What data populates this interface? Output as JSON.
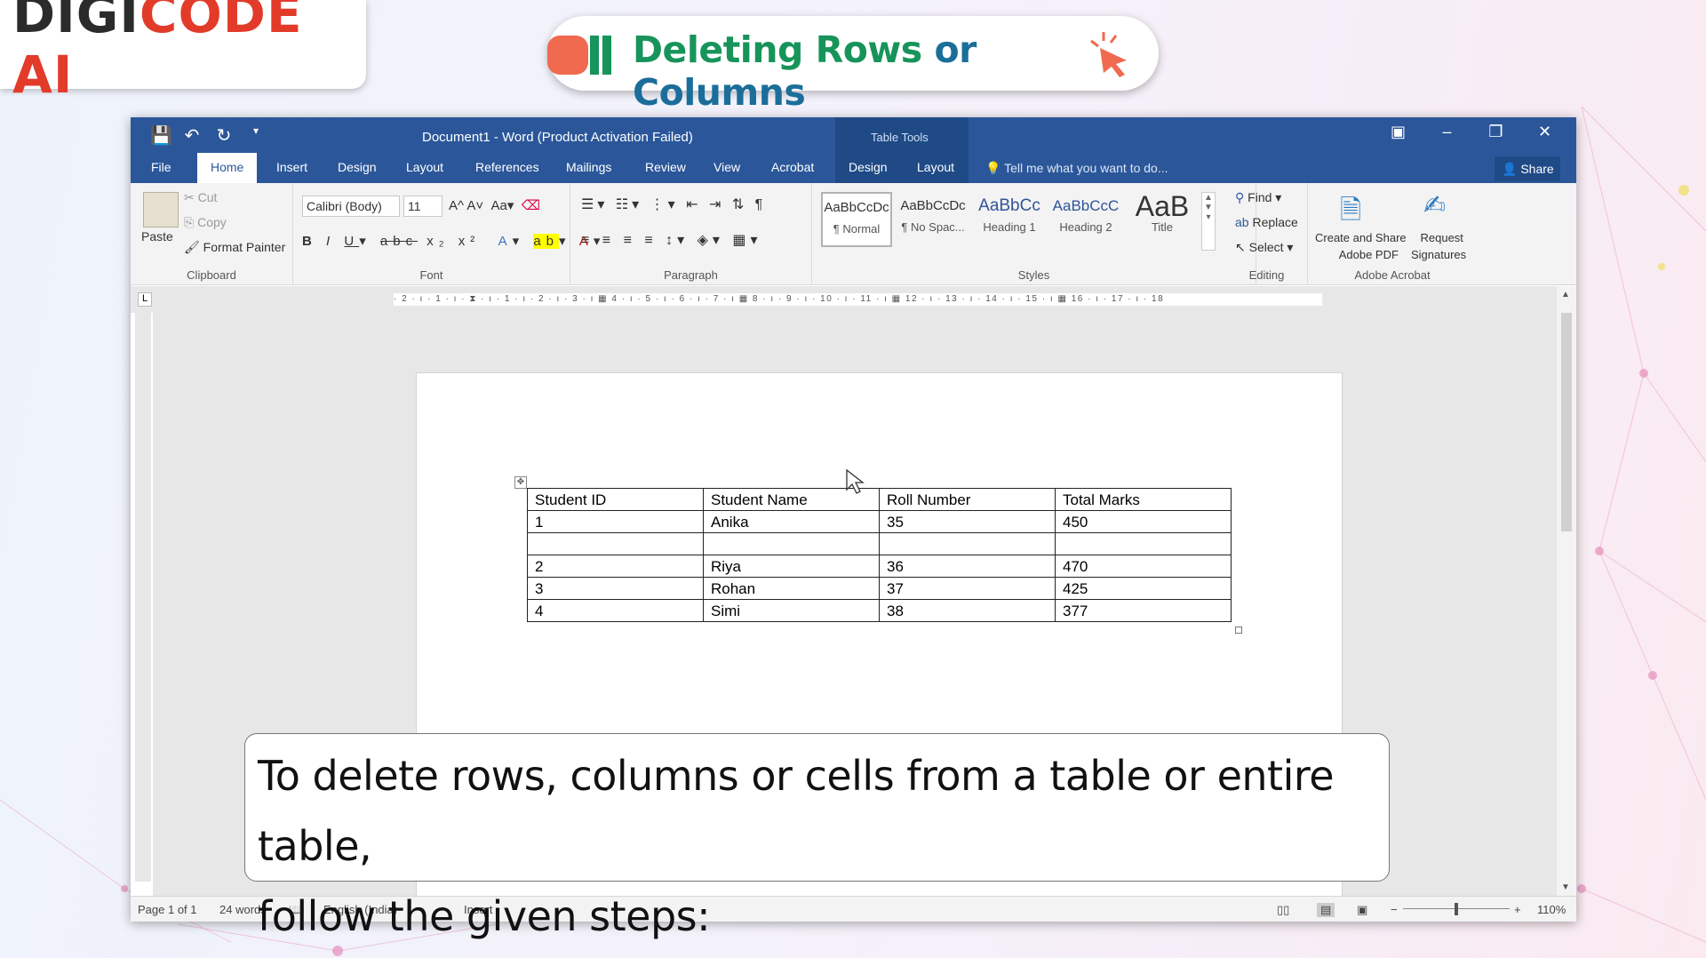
{
  "brand": {
    "logo_dark": "DIGI",
    "logo_red": "CODE",
    "logo_dark2": " AI"
  },
  "banner": {
    "title_green": "Deleting Rows ",
    "title_blue": "or Columns"
  },
  "word": {
    "window_title": "Document1 - Word (Product Activation Failed)",
    "table_tools_label": "Table Tools",
    "tabs": [
      "File",
      "Home",
      "Insert",
      "Design",
      "Layout",
      "References",
      "Mailings",
      "Review",
      "View",
      "Acrobat",
      "Design",
      "Layout"
    ],
    "tell_me": "Tell me what you want to do...",
    "share": "Share",
    "clipboard": {
      "paste": "Paste",
      "cut": "Cut",
      "copy": "Copy",
      "format_painter": "Format Painter",
      "label": "Clipboard"
    },
    "font": {
      "name": "Calibri (Body)",
      "size": "11",
      "label": "Font"
    },
    "paragraph": {
      "label": "Paragraph"
    },
    "styles": {
      "items": [
        {
          "preview": "AaBbCcDc",
          "name": "¶ Normal"
        },
        {
          "preview": "AaBbCcDc",
          "name": "¶ No Spac..."
        },
        {
          "preview": "AaBbCc",
          "name": "Heading 1"
        },
        {
          "preview": "AaBbCcC",
          "name": "Heading 2"
        },
        {
          "preview": "AaB",
          "name": "Title"
        }
      ],
      "label": "Styles"
    },
    "editing": {
      "find": "Find",
      "replace": "Replace",
      "select": "Select",
      "label": "Editing"
    },
    "acrobat": {
      "create_share_1": "Create and Share",
      "create_share_2": "Adobe PDF",
      "request_1": "Request",
      "request_2": "Signatures",
      "label": "Adobe Acrobat"
    },
    "ruler_text": "· 2 · ı · 1 · ı · ⧗ · ı · 1 · ı · 2 · ı · 3 · ı ▦ 4 · ı · 5 · ı · 6 · ı · 7 · ı ▦ 8 · ı · 9 · ı · 10 · ı · 11 · ı ▦ 12 · ı · 13 · ı · 14 · ı · 15 · ı ▦ 16 · ı · 17 · ı · 18",
    "status": {
      "page": "Page 1 of 1",
      "words": "24 words",
      "language": "English (India)",
      "mode": "Insert",
      "zoom": "110%"
    }
  },
  "table": {
    "headers": [
      "Student ID",
      "Student Name",
      "Roll Number",
      "Total Marks"
    ],
    "rows": [
      [
        "1",
        "Anika",
        "35",
        "450"
      ],
      [
        "",
        "",
        "",
        ""
      ],
      [
        "2",
        "Riya",
        "36",
        "470"
      ],
      [
        "3",
        "Rohan",
        "37",
        "425"
      ],
      [
        "4",
        "Simi",
        "38",
        "377"
      ]
    ]
  },
  "caption": {
    "line1": "To delete rows, columns or cells from a table or entire table,",
    "line2": "follow the given steps:"
  }
}
